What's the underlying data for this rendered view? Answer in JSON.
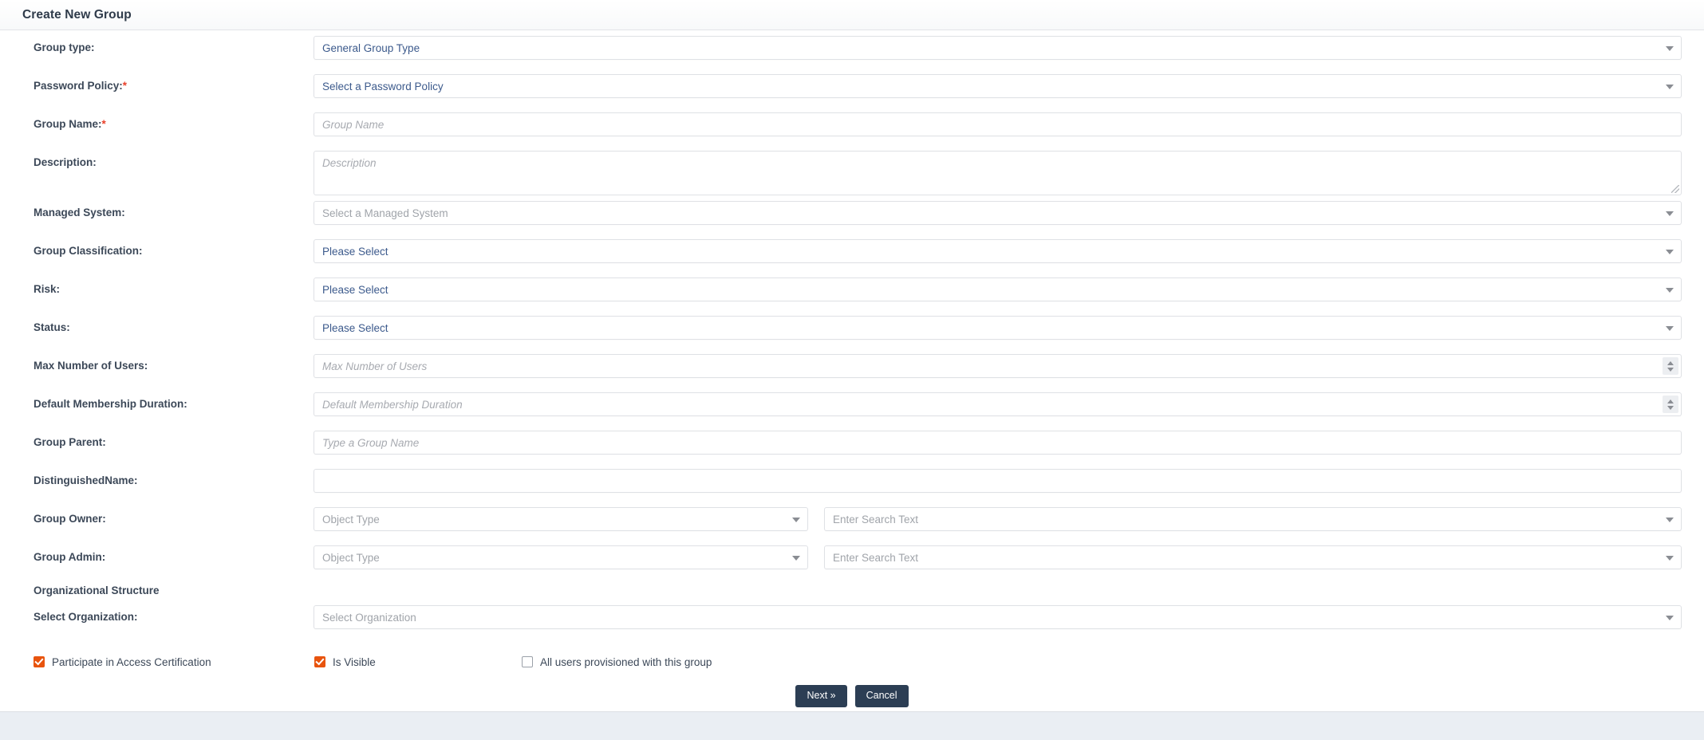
{
  "header": {
    "title": "Create New Group"
  },
  "form": {
    "fields": [
      {
        "label": "Group type:",
        "required": false,
        "control": "select",
        "value": "General Group Type",
        "state": "value"
      },
      {
        "label": "Password Policy:",
        "required": true,
        "control": "select",
        "value": "Select a Password Policy",
        "state": "value"
      },
      {
        "label": "Group Name:",
        "required": true,
        "control": "text",
        "value": "Group Name",
        "state": "placeholder"
      },
      {
        "label": "Description:",
        "required": false,
        "control": "textarea",
        "value": "Description",
        "state": "placeholder"
      },
      {
        "label": "Managed System:",
        "required": false,
        "control": "select",
        "value": "Select a Managed System",
        "state": "placeholder-plain"
      },
      {
        "label": "Group Classification:",
        "required": false,
        "control": "select",
        "value": "Please Select",
        "state": "value"
      },
      {
        "label": "Risk:",
        "required": false,
        "control": "select",
        "value": "Please Select",
        "state": "value"
      },
      {
        "label": "Status:",
        "required": false,
        "control": "select",
        "value": "Please Select",
        "state": "value"
      },
      {
        "label": "Max Number of Users:",
        "required": false,
        "control": "number",
        "value": "Max Number of Users",
        "state": "placeholder"
      },
      {
        "label": "Default Membership Duration:",
        "required": false,
        "control": "number",
        "value": "Default Membership Duration",
        "state": "placeholder"
      },
      {
        "label": "Group Parent:",
        "required": false,
        "control": "text",
        "value": "Type a Group Name",
        "state": "placeholder"
      },
      {
        "label": "DistinguishedName:",
        "required": false,
        "control": "text",
        "value": "",
        "state": "empty"
      }
    ],
    "group_owner": {
      "label": "Group Owner:",
      "object_type_placeholder": "Object Type",
      "search_placeholder": "Enter Search Text"
    },
    "group_admin": {
      "label": "Group Admin:",
      "object_type_placeholder": "Object Type",
      "search_placeholder": "Enter Search Text"
    },
    "org_section": {
      "heading": "Organizational Structure",
      "select_org_label": "Select Organization:",
      "select_org_placeholder": "Select Organization"
    },
    "checkboxes": [
      {
        "label": "Participate in Access Certification",
        "checked": true
      },
      {
        "label": "Is Visible",
        "checked": true
      },
      {
        "label": "All users provisioned with this group",
        "checked": false
      }
    ],
    "buttons": {
      "next": "Next »",
      "cancel": "Cancel"
    }
  },
  "colors": {
    "accent_checkbox": "#e8540e",
    "button_bg": "#2c3e54",
    "required_star": "#e8402a",
    "value_text": "#3c5a8c",
    "footer_bg": "#eaeef3"
  }
}
